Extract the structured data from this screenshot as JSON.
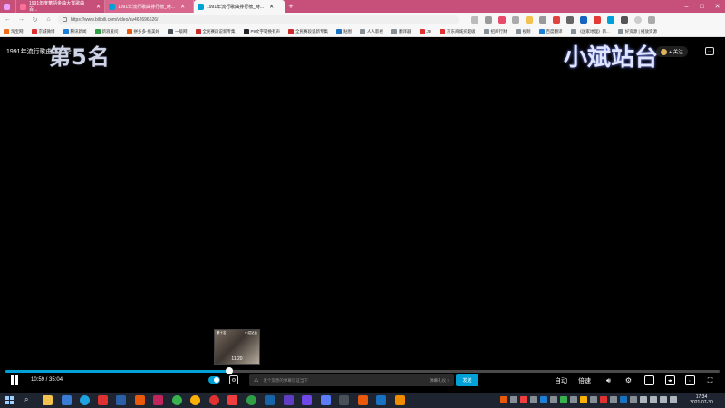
{
  "browser": {
    "tabs": [
      {
        "title": "",
        "active": false
      },
      {
        "title": "1991年度華語金曲大賞歌曲_百...",
        "active": false
      },
      {
        "title": "1991年流行歌曲排行榜_時...",
        "active": false
      },
      {
        "title": "1991年流行歌曲排行榜_時...",
        "active": true
      }
    ],
    "new_tab": "+",
    "window_controls": {
      "minimize": "–",
      "maximize": "□",
      "close": "✕"
    },
    "url": "https://www.bilibili.com/video/av462696626/",
    "bookmarks": [
      "淘宝网",
      "京城微博",
      "腾讯新闻",
      "新浪爱问",
      "拼多多·挑美好",
      "一级网",
      "全民赛段说新专集",
      "P9文字转换有声",
      "全民赛段说新专集",
      "贴图",
      "人人影视",
      "翻译器",
      "JD",
      "京东商城买超级",
      "招商行财",
      "视频",
      "百度翻译",
      "《国家地理》新...",
      "好资源 | 播放资源"
    ]
  },
  "video": {
    "title": "1991年流行歌曲排行榜",
    "overlay_rank": "第5名",
    "overlay_artist": "",
    "watermark": "小斌站台",
    "follow_label": "+ 关注",
    "preview": {
      "time": "11:20",
      "tag_left": "第十名",
      "tag_right": "小斌站台"
    },
    "progress_fraction": 0.313
  },
  "controls": {
    "current_time": "10:59",
    "separator": " / ",
    "duration": "35:04",
    "danmaku_placeholder": "发个友善的弹幕见证当下",
    "danmaku_etiquette": "弹幕礼仪 >",
    "send_label": "发送",
    "auto_label": "自动",
    "speed_label": "倍速"
  },
  "taskbar": {
    "time": "17:34",
    "date": "2021-07-30"
  }
}
